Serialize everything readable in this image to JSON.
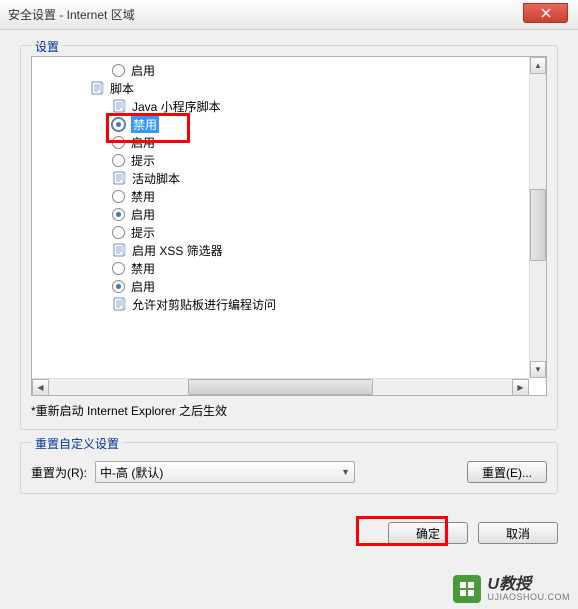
{
  "window": {
    "title": "安全设置 - Internet 区域"
  },
  "settings": {
    "legend": "设置",
    "items": [
      {
        "level": 3,
        "type": "radio",
        "label": "启用",
        "selected": false
      },
      {
        "level": 2,
        "type": "category",
        "label": "脚本"
      },
      {
        "level": 3,
        "type": "subcategory",
        "label": "Java 小程序脚本"
      },
      {
        "level": 3,
        "type": "radio",
        "label": "禁用",
        "selected": true,
        "highlighted": true
      },
      {
        "level": 3,
        "type": "radio",
        "label": "启用",
        "selected": false
      },
      {
        "level": 3,
        "type": "radio",
        "label": "提示",
        "selected": false
      },
      {
        "level": 3,
        "type": "subcategory",
        "label": "活动脚本"
      },
      {
        "level": 3,
        "type": "radio",
        "label": "禁用",
        "selected": false
      },
      {
        "level": 3,
        "type": "radio",
        "label": "启用",
        "selected": true
      },
      {
        "level": 3,
        "type": "radio",
        "label": "提示",
        "selected": false
      },
      {
        "level": 3,
        "type": "subcategory",
        "label": "启用 XSS 筛选器"
      },
      {
        "level": 3,
        "type": "radio",
        "label": "禁用",
        "selected": false
      },
      {
        "level": 3,
        "type": "radio",
        "label": "启用",
        "selected": true
      },
      {
        "level": 3,
        "type": "subcategory",
        "label": "允许对剪贴板进行编程访问"
      }
    ],
    "note": "*重新启动 Internet Explorer 之后生效"
  },
  "reset": {
    "legend": "重置自定义设置",
    "label": "重置为(R):",
    "comboValue": "中-高 (默认)",
    "buttonLabel": "重置(E)..."
  },
  "buttons": {
    "ok": "确定",
    "cancel": "取消"
  },
  "watermark": {
    "main": "U教授",
    "sub": "UJIAOSHOU.COM"
  }
}
